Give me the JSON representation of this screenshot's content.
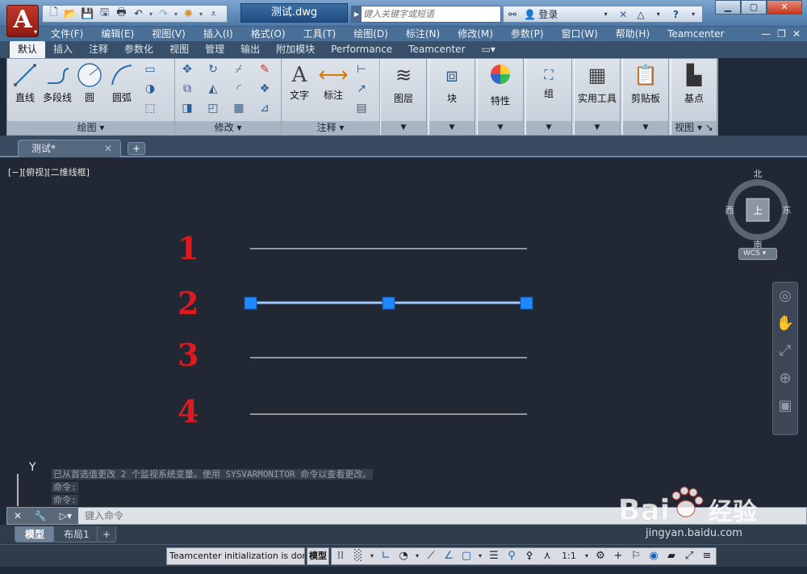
{
  "app": {
    "logo_letter": "A"
  },
  "title": {
    "document": "测试.dwg"
  },
  "search": {
    "placeholder": "键入关键字或短语"
  },
  "infocenter": {
    "login": "登录"
  },
  "menu": [
    "文件(F)",
    "编辑(E)",
    "视图(V)",
    "插入(I)",
    "格式(O)",
    "工具(T)",
    "绘图(D)",
    "标注(N)",
    "修改(M)",
    "参数(P)",
    "窗口(W)",
    "帮助(H)",
    "Teamcenter"
  ],
  "ribbon_tabs": [
    "默认",
    "插入",
    "注释",
    "参数化",
    "视图",
    "管理",
    "输出",
    "附加模块",
    "Performance",
    "Teamcenter"
  ],
  "ribbon": {
    "draw": {
      "title": "绘图",
      "line": "直线",
      "polyline": "多段线",
      "circle": "圆",
      "arc": "圆弧"
    },
    "modify": {
      "title": "修改"
    },
    "annotation": {
      "title": "注释",
      "text": "文字",
      "dimension": "标注"
    },
    "layers": "图层",
    "block": "块",
    "properties": "特性",
    "groups": "组",
    "utilities": "实用工具",
    "clipboard": "剪贴板",
    "view": {
      "basepoint": "基点",
      "title": "视图"
    }
  },
  "doc_tab": {
    "label": "测试*"
  },
  "viewport": {
    "label": "[−][俯视][二维线框]"
  },
  "viewcube": {
    "north": "北",
    "south": "南",
    "east": "东",
    "west": "西",
    "top": "上",
    "wcs": "WCS"
  },
  "drawing": {
    "numbers": [
      "1",
      "2",
      "3",
      "4"
    ],
    "selected_line": 2,
    "line_color": "#d8d8d8",
    "select_color": "#1e88ff",
    "number_color": "#e0191f"
  },
  "ucs": {
    "y_label": "Y"
  },
  "command_history": [
    "已从首选值更改 2 个监视系统变量。使用 SYSVARMONITOR 命令以查看更改。",
    "命令:",
    "命令:"
  ],
  "command_input": {
    "placeholder": "键入命令"
  },
  "layout_tabs": [
    "模型",
    "布局1"
  ],
  "status": {
    "message": "Teamcenter initialization is done",
    "model": "模型",
    "scale": "1:1"
  },
  "watermark": {
    "brand": "Bai",
    "brand_cn": "经验",
    "url": "jingyan.baidu.com"
  }
}
